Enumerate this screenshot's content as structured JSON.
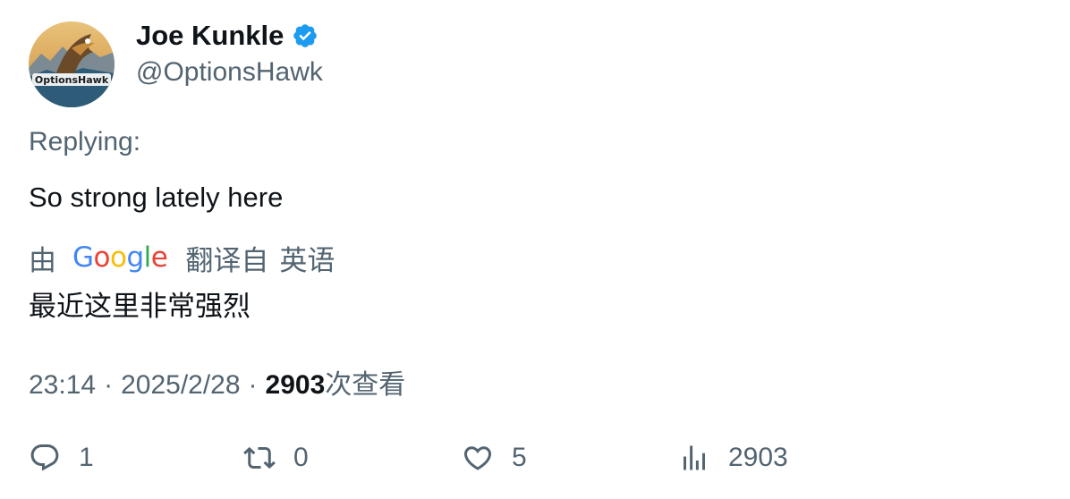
{
  "author": {
    "name": "Joe Kunkle",
    "handle": "@OptionsHawk",
    "avatar_text": "OptionsHawk",
    "verified_icon": "verified-badge-icon"
  },
  "tweet": {
    "replying_label": "Replying:",
    "text": "So strong lately here",
    "translation": {
      "by_label": "由",
      "provider": "Google",
      "from_label": "翻译自",
      "source_language": "英语",
      "translated_text": "最近这里非常强烈"
    },
    "meta": {
      "time": "23:14",
      "separator": "·",
      "date": "2025/2/28",
      "views_count": "2903",
      "views_label": "次查看"
    }
  },
  "actions": {
    "reply": {
      "icon": "reply-icon",
      "count": "1"
    },
    "retweet": {
      "icon": "retweet-icon",
      "count": "0"
    },
    "like": {
      "icon": "heart-icon",
      "count": "5"
    },
    "views": {
      "icon": "views-icon",
      "count": "2903"
    }
  },
  "colors": {
    "text_primary": "#0f1419",
    "text_secondary": "#536471",
    "verified_blue": "#1d9bf0"
  }
}
